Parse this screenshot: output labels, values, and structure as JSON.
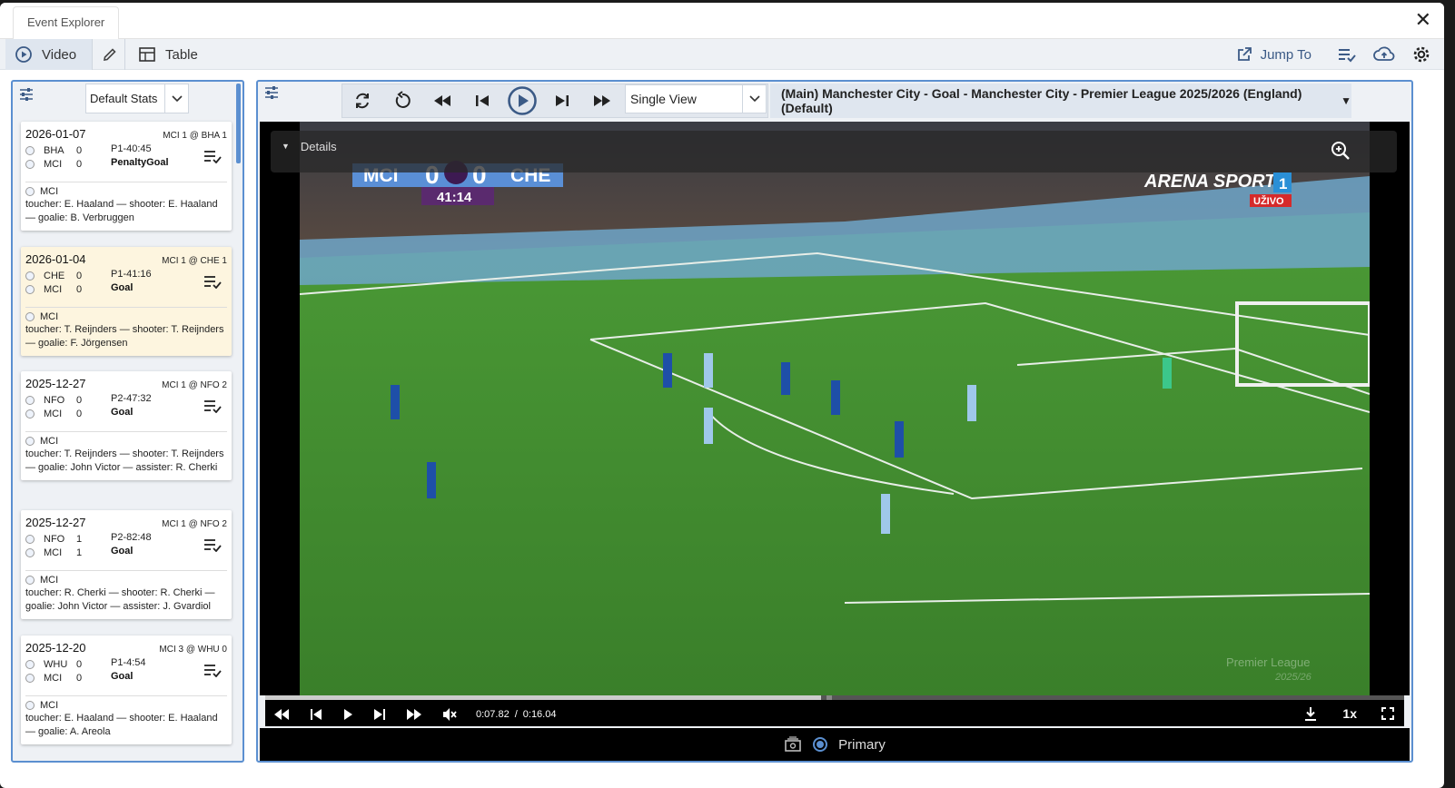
{
  "window": {
    "title": "Event Explorer"
  },
  "toolbar": {
    "video_label": "Video",
    "table_label": "Table",
    "jump_label": "Jump To"
  },
  "left_panel": {
    "stats_select": "Default Stats",
    "cards": [
      {
        "date": "2026-01-07",
        "match": "MCI 1 @ BHA 1",
        "team1": "BHA",
        "score1": "0",
        "team2": "MCI",
        "score2": "0",
        "clock": "P1-40:45",
        "type": "PenaltyGoal",
        "event_team": "MCI",
        "desc": "toucher: E. Haaland — shooter: E. Haaland — goalie: B. Verbruggen",
        "selected": false
      },
      {
        "date": "2026-01-04",
        "match": "MCI 1 @ CHE 1",
        "team1": "CHE",
        "score1": "0",
        "team2": "MCI",
        "score2": "0",
        "clock": "P1-41:16",
        "type": "Goal",
        "event_team": "MCI",
        "desc": "toucher: T. Reijnders — shooter: T. Reijnders — goalie: F. Jörgensen",
        "selected": true
      },
      {
        "date": "2025-12-27",
        "match": "MCI 1 @ NFO 2",
        "team1": "NFO",
        "score1": "0",
        "team2": "MCI",
        "score2": "0",
        "clock": "P2-47:32",
        "type": "Goal",
        "event_team": "MCI",
        "desc": "toucher: T. Reijnders — shooter: T. Reijnders — goalie: John Victor — assister: R. Cherki",
        "selected": false
      },
      {
        "date": "2025-12-27",
        "match": "MCI 1 @ NFO 2",
        "team1": "NFO",
        "score1": "1",
        "team2": "MCI",
        "score2": "1",
        "clock": "P2-82:48",
        "type": "Goal",
        "event_team": "MCI",
        "desc": "toucher: R. Cherki — shooter: R. Cherki — goalie: John Victor — assister: J. Gvardiol",
        "selected": false
      },
      {
        "date": "2025-12-20",
        "match": "MCI 3 @ WHU 0",
        "team1": "WHU",
        "score1": "0",
        "team2": "MCI",
        "score2": "0",
        "clock": "P1-4:54",
        "type": "Goal",
        "event_team": "MCI",
        "desc": "toucher: E. Haaland — shooter: E. Haaland — goalie: A. Areola",
        "selected": false
      }
    ]
  },
  "player": {
    "view_select": "Single View",
    "clip_title": "(Main) Manchester City - Goal - Manchester City - Premier League 2025/2026 (England) (Default)",
    "details_label": "Details",
    "scorebug": {
      "home": "MCI",
      "home_score": "0",
      "away": "CHE",
      "away_score": "0",
      "clock": "41:14"
    },
    "broadcaster": "ARENA SPORT",
    "broadcaster_channel": "1",
    "broadcaster_live": "UŽIVO",
    "watermark": "Premier League",
    "watermark_sub": "2025/26",
    "time_current": "0:07.82",
    "time_sep": "/",
    "time_total": "0:16.04",
    "progress": 0.488,
    "speed": "1x",
    "source_label": "Primary"
  },
  "colors": {
    "accent": "#5b8fd0",
    "selected_card": "#fdf5df",
    "pitch_green": "#3f8a2e"
  }
}
